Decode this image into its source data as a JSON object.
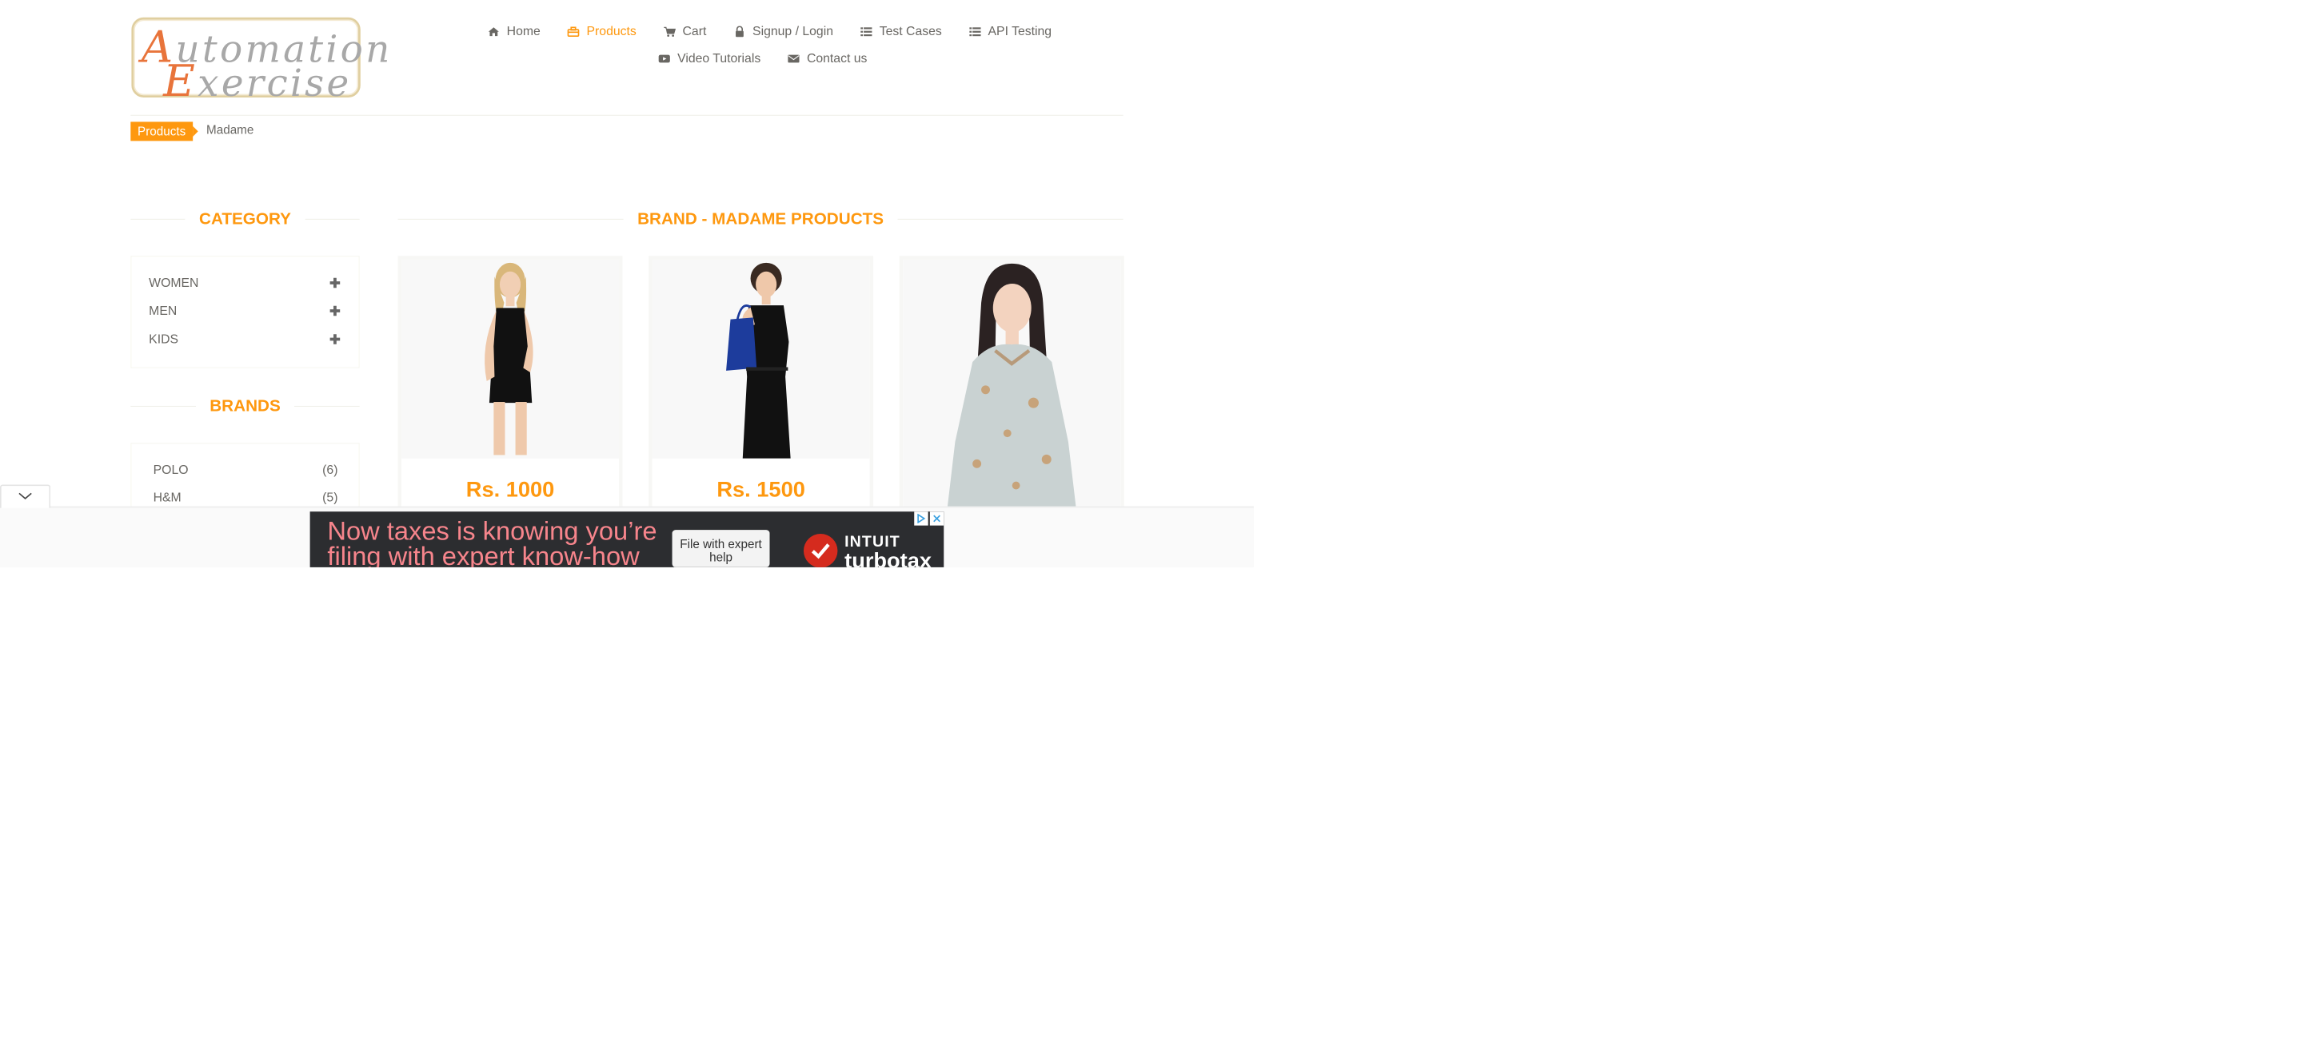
{
  "logo": {
    "line1": "Automation",
    "line2": "Exercise"
  },
  "nav": {
    "row1": [
      {
        "label": "Home",
        "icon": "home-icon"
      },
      {
        "label": "Products",
        "icon": "briefcase-icon",
        "active": true
      },
      {
        "label": "Cart",
        "icon": "cart-icon"
      },
      {
        "label": "Signup / Login",
        "icon": "lock-icon"
      },
      {
        "label": "Test Cases",
        "icon": "list-icon"
      },
      {
        "label": "API Testing",
        "icon": "list-icon"
      }
    ],
    "row2": [
      {
        "label": "Video Tutorials",
        "icon": "youtube-play-icon"
      },
      {
        "label": "Contact us",
        "icon": "envelope-icon"
      }
    ]
  },
  "breadcrumb": {
    "active": "Products",
    "current": "Madame"
  },
  "sidebar": {
    "category_title": "Category",
    "categories": [
      {
        "label": "WOMEN"
      },
      {
        "label": "MEN"
      },
      {
        "label": "KIDS"
      }
    ],
    "brands_title": "Brands",
    "brands": [
      {
        "name": "POLO",
        "count": "(6)"
      },
      {
        "name": "H&M",
        "count": "(5)"
      }
    ]
  },
  "products": {
    "title": "Brand - Madame Products",
    "items": [
      {
        "price": "Rs. 1000",
        "image": "woman-black-dress"
      },
      {
        "price": "Rs. 1500",
        "image": "woman-black-dress-with-bag"
      },
      {
        "price": "",
        "image": "woman-floral-blouse"
      }
    ]
  },
  "ad": {
    "headline": "Now taxes is knowing you’re filing with expert know-how",
    "button": "File with expert help",
    "brand_top": "INTUIT",
    "brand_bottom": "turbotax"
  },
  "colors": {
    "accent": "#fe980f",
    "text": "#696763",
    "ad_bg": "#2c2d30",
    "ad_text": "#f7858c"
  }
}
